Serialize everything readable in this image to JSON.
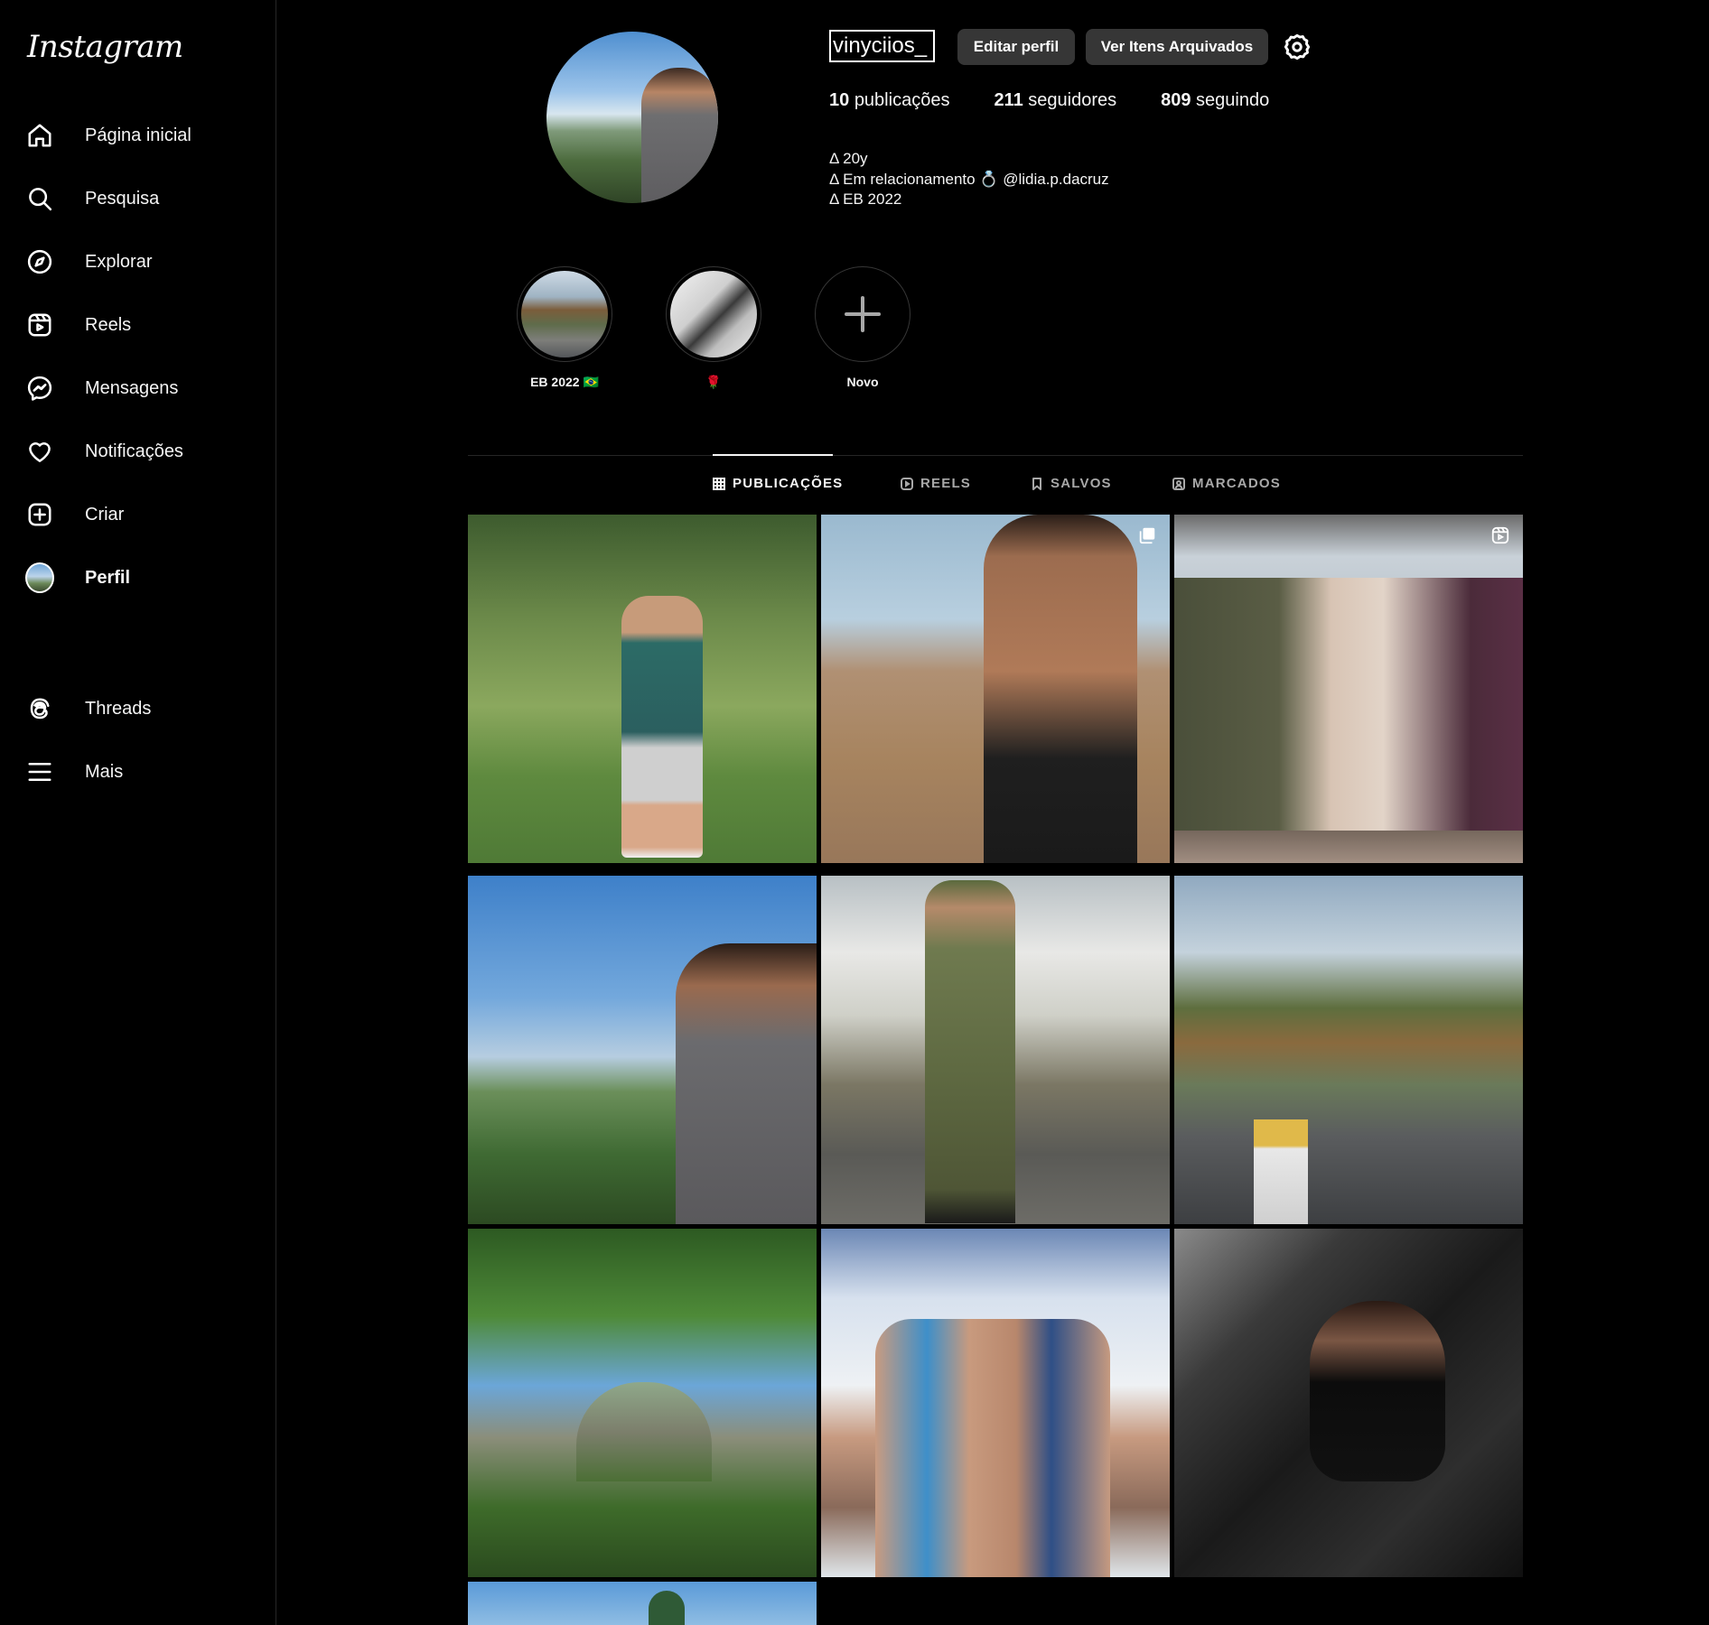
{
  "app": {
    "logo": "Instagram"
  },
  "sidebar": {
    "items": [
      {
        "label": "Página inicial",
        "icon": "home-icon"
      },
      {
        "label": "Pesquisa",
        "icon": "search-icon"
      },
      {
        "label": "Explorar",
        "icon": "compass-icon"
      },
      {
        "label": "Reels",
        "icon": "reels-icon"
      },
      {
        "label": "Mensagens",
        "icon": "messenger-icon"
      },
      {
        "label": "Notificações",
        "icon": "heart-icon"
      },
      {
        "label": "Criar",
        "icon": "plus-square-icon"
      },
      {
        "label": "Perfil",
        "icon": "avatar"
      }
    ],
    "bottom_items": [
      {
        "label": "Threads",
        "icon": "threads-icon"
      },
      {
        "label": "Mais",
        "icon": "menu-icon"
      }
    ]
  },
  "profile": {
    "username": "vinyciios_",
    "edit_label": "Editar perfil",
    "archive_label": "Ver Itens Arquivados",
    "stats": {
      "posts_count": "10",
      "posts_label": "publicações",
      "followers_count": "211",
      "followers_label": "seguidores",
      "following_count": "809",
      "following_label": "seguindo"
    },
    "bio": [
      "Δ 20y",
      "Δ Em relacionamento 💍 @lidia.p.dacruz",
      "Δ EB 2022"
    ]
  },
  "highlights": [
    {
      "label": "EB 2022 🇧🇷"
    },
    {
      "label": "🌹"
    },
    {
      "label": "Novo"
    }
  ],
  "tabs": [
    {
      "label": "PUBLICAÇÕES",
      "icon": "grid-icon",
      "active": true
    },
    {
      "label": "REELS",
      "icon": "reels-icon",
      "active": false
    },
    {
      "label": "SALVOS",
      "icon": "bookmark-icon",
      "active": false
    },
    {
      "label": "MARCADOS",
      "icon": "tagged-icon",
      "active": false
    }
  ],
  "posts": [
    {
      "badge": null
    },
    {
      "badge": "multi-post-icon"
    },
    {
      "badge": "reel-icon"
    },
    {
      "badge": null
    },
    {
      "badge": null
    },
    {
      "badge": null
    },
    {
      "badge": null
    },
    {
      "badge": null
    },
    {
      "badge": null
    },
    {
      "badge": null
    }
  ],
  "colors": {
    "background": "#000000",
    "button": "#363636",
    "divider": "#262626",
    "text": "#f5f5f5",
    "muted": "#a8a8a8"
  }
}
